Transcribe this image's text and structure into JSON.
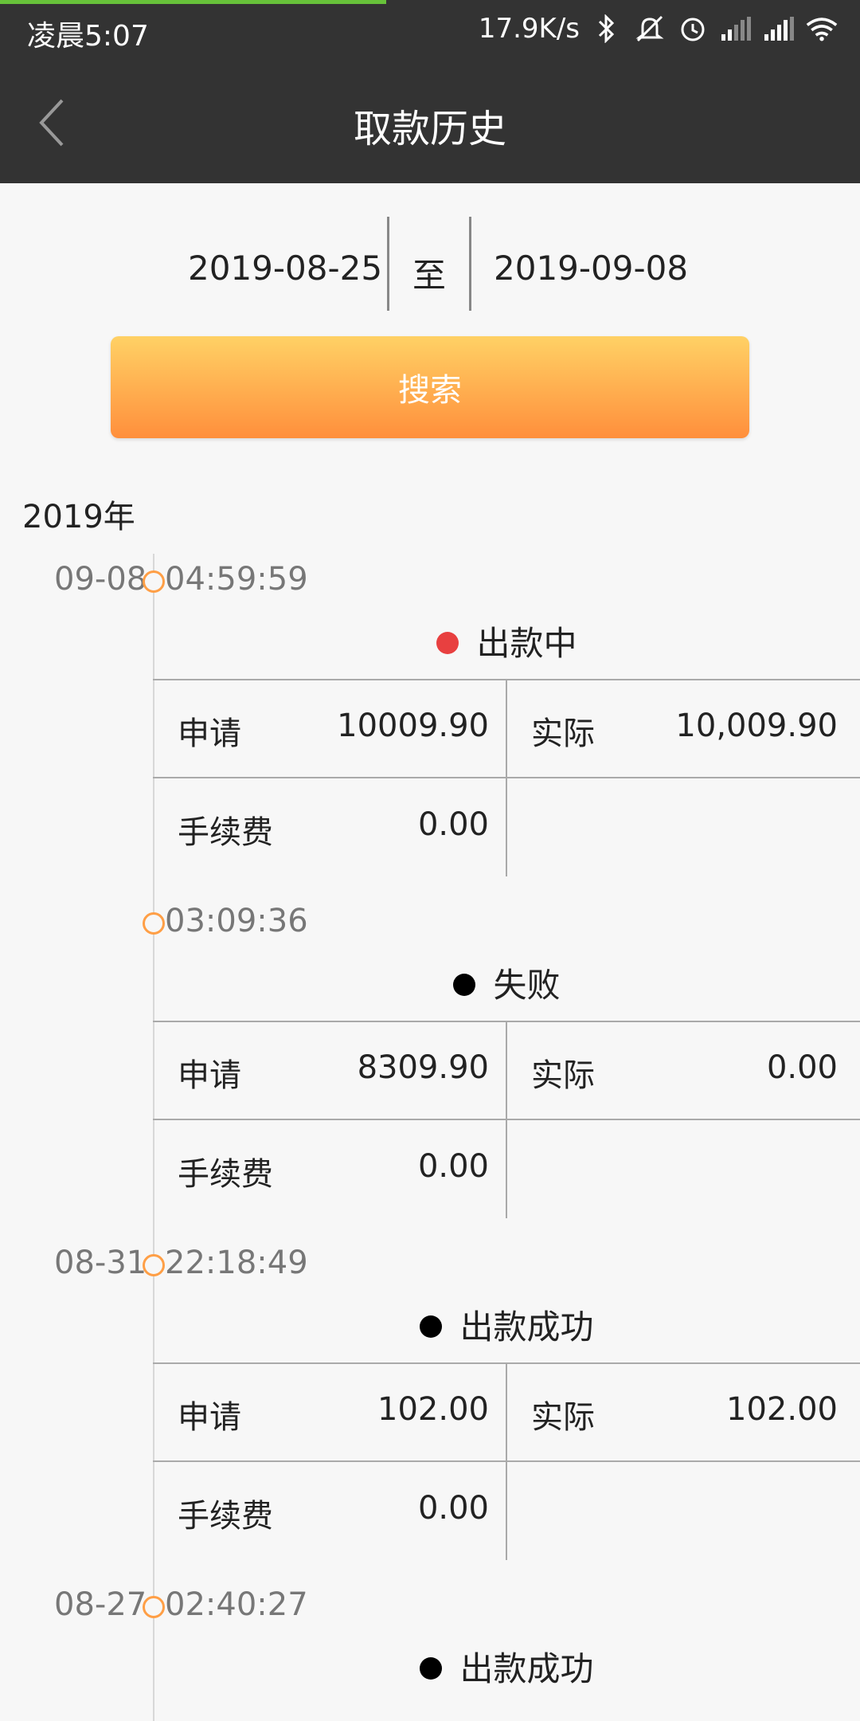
{
  "status_bar": {
    "time": "凌晨5:07",
    "speed": "17.9K/s",
    "icons": [
      "bluetooth-icon",
      "mute-icon",
      "alarm-icon",
      "signal-icon",
      "signal-icon",
      "wifi-icon"
    ]
  },
  "header": {
    "title": "取款历史"
  },
  "date_range": {
    "start": "2019-08-25",
    "separator": "至",
    "end": "2019-09-08"
  },
  "search_button": "搜索",
  "year": "2019年",
  "status_colors": {
    "processing": "#e84040",
    "default": "#000000"
  },
  "labels": {
    "apply": "申请",
    "actual": "实际",
    "fee": "手续费"
  },
  "entries": [
    {
      "date": "09-08",
      "time": "04:59:59",
      "status": "出款中",
      "status_color": "#e84040",
      "apply": "10009.90",
      "actual": "10,009.90",
      "fee": "0.00"
    },
    {
      "date": "",
      "time": "03:09:36",
      "status": "失败",
      "status_color": "#000000",
      "apply": "8309.90",
      "actual": "0.00",
      "fee": "0.00"
    },
    {
      "date": "08-31",
      "time": "22:18:49",
      "status": "出款成功",
      "status_color": "#000000",
      "apply": "102.00",
      "actual": "102.00",
      "fee": "0.00"
    },
    {
      "date": "08-27",
      "time": "02:40:27",
      "status": "出款成功",
      "status_color": "#000000",
      "apply": "",
      "actual": "",
      "fee": ""
    }
  ]
}
